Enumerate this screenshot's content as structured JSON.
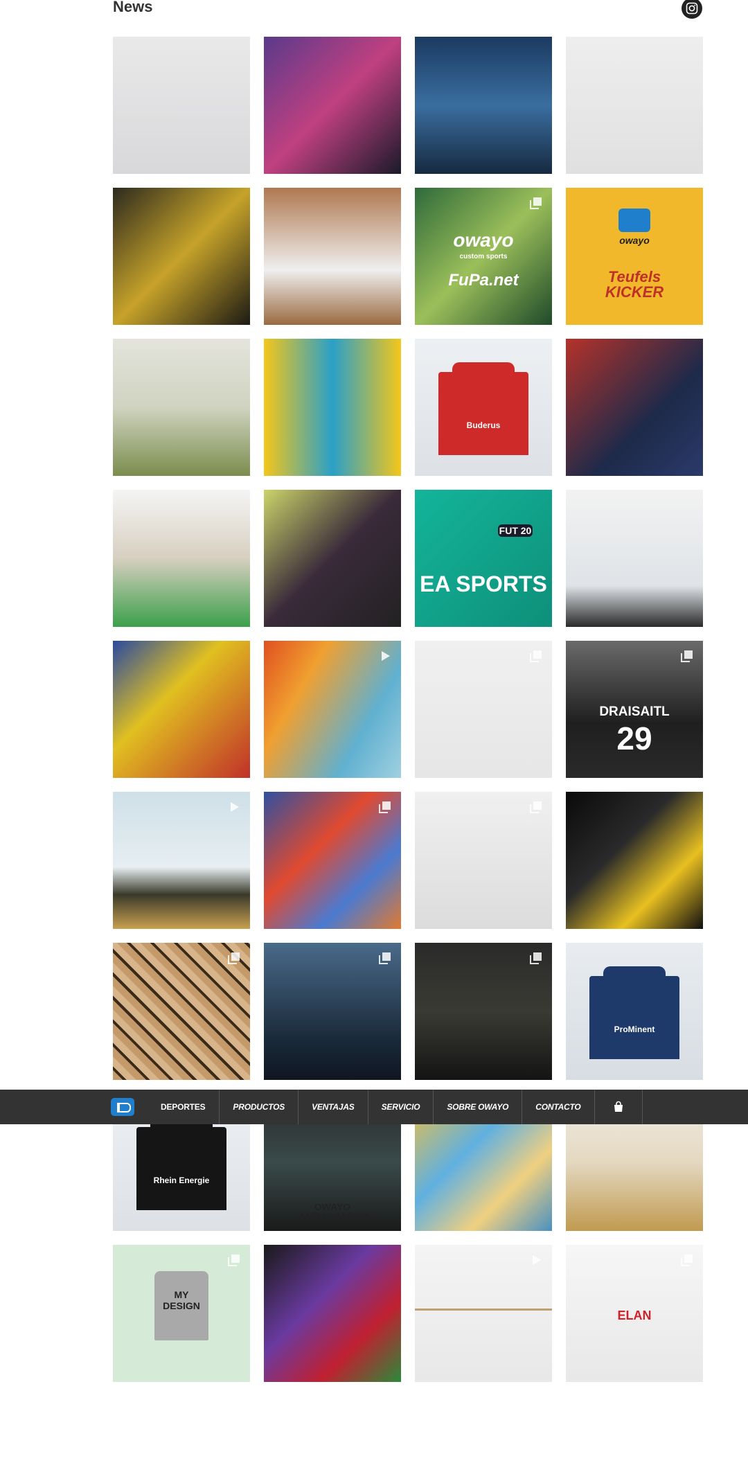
{
  "section": {
    "title": "News",
    "instagram_icon": "instagram-icon"
  },
  "nav": {
    "logo_icon": "owayo-logo-icon",
    "items": [
      "DEPORTES",
      "PRODUCTOS",
      "VENTAJAS",
      "SERVICIO",
      "SOBRE OWAYO",
      "CONTACTO"
    ],
    "cart_icon": "shopping-bag-icon"
  },
  "posts": [
    {
      "name": "post-woman-seated-on-box",
      "bg": "linear-gradient(#e9e9ea,#d8d8da)",
      "overlay": null
    },
    {
      "name": "post-esports-arena",
      "bg": "linear-gradient(135deg,#5a3a8a,#c04080 50%,#1a1a2a)",
      "overlay": null
    },
    {
      "name": "post-trophy-celebration",
      "bg": "linear-gradient(#1b3a60,#3a6ea0 50%,#162a40)",
      "overlay": null
    },
    {
      "name": "post-ea-sports-kits",
      "bg": "linear-gradient(#eeeeee,#e0e0e0)",
      "overlay": null
    },
    {
      "name": "post-team-huddle",
      "bg": "linear-gradient(135deg,#2c2a1e,#c7a32a 50%,#1c1a14)",
      "overlay": null
    },
    {
      "name": "post-basketball-team",
      "bg": "linear-gradient(#b07850,#efefef 60%,#9a6a40)",
      "overlay": null
    },
    {
      "name": "post-owayo-fupa-collab",
      "bg": "linear-gradient(135deg,#2e6a3a,#9bbf5a 50%,#1f4a2a)",
      "overlay": "owayo-fupa",
      "glyph": "gallery"
    },
    {
      "name": "post-owayo-teufelskicker",
      "bg": "#f0b82a",
      "overlay": "owayo-teufels"
    },
    {
      "name": "post-football-in-fog",
      "bg": "linear-gradient(#e4e4dc,#cfd3c0 50%,#7c8d4e)",
      "overlay": null
    },
    {
      "name": "post-player-yellow-backdrop",
      "bg": "linear-gradient(90deg,#f4c61a,#2aa0c8 50%,#f4c61a)",
      "overlay": null
    },
    {
      "name": "post-red-hockey-jersey",
      "bg": "linear-gradient(#edf0f3,#dde1e6)",
      "overlay": "jersey-red"
    },
    {
      "name": "post-handball-player",
      "bg": "linear-gradient(135deg,#b5322a,#1e2a4a 60%,#2a3a6a)",
      "overlay": null
    },
    {
      "name": "post-sports-hall",
      "bg": "linear-gradient(#f5f5f5,#d7cfc0 50%,#3ba04a)",
      "overlay": null
    },
    {
      "name": "post-jersey-closeup",
      "bg": "linear-gradient(135deg,#cbd46a,#3a2a3a 50%,#222)",
      "overlay": null
    },
    {
      "name": "post-ea-sports-fut20",
      "bg": "linear-gradient(135deg,#13b59a,#0e8f7a)",
      "overlay": "easports"
    },
    {
      "name": "post-cycling-office",
      "bg": "linear-gradient(#f2f2f2,#dfe3e7 70%,#2a2a2a)",
      "overlay": null
    },
    {
      "name": "post-handball-match",
      "bg": "linear-gradient(135deg,#2a4aa0,#e0c020 40%,#c0302a)",
      "overlay": null
    },
    {
      "name": "post-fabric-colors",
      "bg": "linear-gradient(120deg,#e05020,#f0a030 30%,#60b0d0 70%,#a0d0e0)",
      "overlay": null,
      "glyph": "play"
    },
    {
      "name": "post-cyclist-bib-shorts",
      "bg": "linear-gradient(#f0f0f0,#e6e6e6)",
      "overlay": null,
      "glyph": "gallery"
    },
    {
      "name": "post-draisaitl-jersey",
      "bg": "linear-gradient(#6a6a6a,#1f1f1f 60%,#2a2a2a)",
      "overlay": "draisaitl",
      "glyph": "gallery"
    },
    {
      "name": "post-cyclist-wind-turbine",
      "bg": "linear-gradient(#cfe0e8,#e6eef2 55%,#3a3a2a 75%,#c8a050)",
      "overlay": null,
      "glyph": "play"
    },
    {
      "name": "post-colorful-cycling-kit",
      "bg": "linear-gradient(135deg,#3050a0,#e04a30 40%,#4a7ad0 70%,#e07a30)",
      "overlay": null,
      "glyph": "gallery"
    },
    {
      "name": "post-woman-black-shirt",
      "bg": "linear-gradient(#f0f0f0,#dcdcdc)",
      "overlay": null,
      "glyph": "gallery"
    },
    {
      "name": "post-basketball-dunk",
      "bg": "linear-gradient(135deg,#0a0a0a,#2a2a2a 40%,#e8c020 70%,#101010)",
      "overlay": null
    },
    {
      "name": "post-leopard-print-kit",
      "bg": "repeating-linear-gradient(45deg,#c49a6a 0 10px,#3a2a1a 10px 14px,#d8b48a 14px 24px)",
      "overlay": null,
      "glyph": "gallery"
    },
    {
      "name": "post-model-blue-shirt",
      "bg": "linear-gradient(#4a6a8a,#1a2a3a 70%,#0f1620)",
      "overlay": null,
      "glyph": "gallery"
    },
    {
      "name": "post-model-forest",
      "bg": "linear-gradient(#2a2a2a,#3a3a34 50%,#141414)",
      "overlay": null,
      "glyph": "gallery"
    },
    {
      "name": "post-blue-hockey-jersey",
      "bg": "linear-gradient(#e8ecf0,#d8dde3)",
      "overlay": "jersey-blue"
    },
    {
      "name": "post-rhein-energie-jersey",
      "bg": "linear-gradient(#edf0f3,#dde1e6)",
      "overlay": "jersey-black"
    },
    {
      "name": "post-owayo-ambassador",
      "bg": "linear-gradient(#2a2a2a,#3a4a4a 50%,#1a1a1a)",
      "overlay": "ambassador"
    },
    {
      "name": "post-camouflage-print",
      "bg": "linear-gradient(135deg,#f0c040,#60b0e0 40%,#f0d080 70%,#4a90c0)",
      "overlay": null
    },
    {
      "name": "post-runner-field",
      "bg": "linear-gradient(#f0ece4,#e4d8c0 50%,#c09a50)",
      "overlay": null
    },
    {
      "name": "post-my-design",
      "bg": "#d6ebd7",
      "overlay": "mydesign",
      "glyph": "gallery"
    },
    {
      "name": "post-gaming-jerseys",
      "bg": "linear-gradient(135deg,#1a1a1a,#6a3aa0 40%,#c02030 70%,#2a8a3a)",
      "overlay": null
    },
    {
      "name": "post-hanging-shirts",
      "bg": "linear-gradient(#f4f4f4,#e8e8e8)",
      "overlay": "hangers",
      "glyph": "play"
    },
    {
      "name": "post-basketball-player-elan",
      "bg": "linear-gradient(#f6f6f6,#e8e8e8)",
      "overlay": "elan",
      "glyph": "gallery"
    }
  ],
  "overlay_text": {
    "owayo": "owayo",
    "custom_sports": "custom sports",
    "fupa": "FuPa.net",
    "teufels": "Teufels KICKER",
    "easports": "EA SPORTS",
    "fut20": "FUT 20",
    "draisaitl_name": "DRAISAITL",
    "draisaitl_number": "29",
    "rhein": "Rhein Energie",
    "ambassador": "OWAYO AMBASSADOR",
    "mydesign": "MY DESIGN",
    "elan": "ELAN",
    "buderus": "Buderus",
    "prominent": "ProMinent"
  }
}
